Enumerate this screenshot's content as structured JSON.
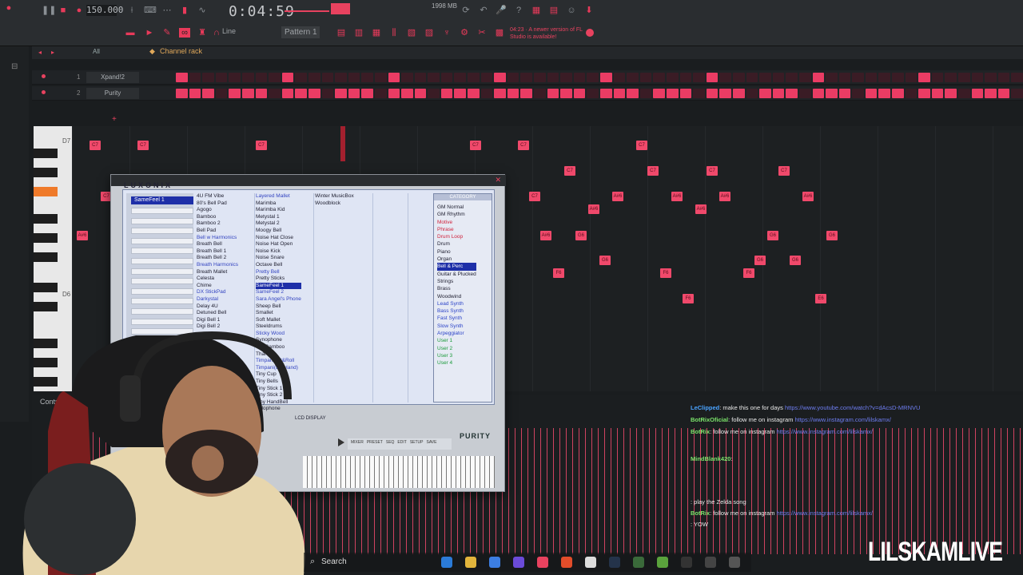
{
  "toolbar": {
    "tempo": "150.000",
    "time": "0:04:59",
    "line_mode": "Line",
    "pattern": "Pattern 1",
    "memory": "1998 MB",
    "notice": "04:23 · A newer version of FL Studio is available!",
    "accent": "#e83a5a"
  },
  "channel_rack": {
    "filter": "All",
    "title": "Channel rack",
    "channels": [
      {
        "num": "1",
        "name": "Xpand!2"
      },
      {
        "num": "2",
        "name": "Purity"
      }
    ]
  },
  "piano_roll": {
    "key_labels": [
      "D7",
      "D6"
    ],
    "notes": [
      "C7",
      "C7",
      "C7",
      "C7",
      "C7",
      "C7",
      "C7",
      "C7",
      "C7",
      "C7",
      "C7",
      "C7",
      "A#6",
      "A#6",
      "A#6",
      "A#6",
      "A#6",
      "A#6",
      "A#6",
      "A#6",
      "G6",
      "G6",
      "G6",
      "G6",
      "G6",
      "G6",
      "F6",
      "F6",
      "F6",
      "F6",
      "E6",
      "E6",
      "E6",
      "E6",
      "D6",
      "D6",
      "D6",
      "D6"
    ],
    "control_label": "Control"
  },
  "plugin": {
    "brand": "LUXONIX",
    "bank": "SameFeel 1",
    "col1": [
      "4U FM Vibe",
      "80's Bell Pad",
      "Agogo",
      "Bamboo",
      "Bamboo 2",
      "Bell Pad",
      "Bell w Harmonics",
      "Breath Bell",
      "Breath Bell 1",
      "Breath Bell 2",
      "Breath Harmonics",
      "Breath Mallet",
      "Celesta",
      "Chime",
      "DX StickPad",
      "Darkystal",
      "Delay 4U",
      "Detuned Bell",
      "Digi Bell 1",
      "Digi Bell 2"
    ],
    "col2": [
      "Layered Mallet",
      "Marimba",
      "Marimba Kid",
      "Metystal 1",
      "Metystal 2",
      "Moogy Bell",
      "Noise Hat Close",
      "Noise Hat Open",
      "Noise Kick",
      "Noise Snare",
      "Octave Bell",
      "Pretty Bell",
      "Pretty Sticks",
      "SameFeel 1",
      "SameFeel 2",
      "Sara Angel's Phone",
      "Sheep Bell",
      "Smallet",
      "Soft Mallet",
      "Steeldrums",
      "Sticky Wood",
      "Synophone",
      "Tek Bamboo",
      "Thai",
      "Timpani Hit&Roll",
      "Timpani(LR Hand)",
      "Tiny Cup",
      "Tiny Bells",
      "Tiny Stick 1",
      "Tiny Stick 2",
      "Tiny HandBell",
      "Xylophone"
    ],
    "col3": [
      "Winter MusicBox",
      "Woodblock"
    ],
    "category_title": "CATEGORY",
    "categories": [
      "GM Normal",
      "GM Rhythm",
      "Motive",
      "Phrase",
      "Drum Loop",
      "Drum",
      "Piano",
      "Organ",
      "Bell & Perc",
      "Guitar & Plucked",
      "Strings",
      "Brass",
      "Woodwind",
      "Lead Synth",
      "Bass Synth",
      "Fast Synth",
      "Slow Synth",
      "Arpeggiator",
      "User 1",
      "User 2",
      "User 3",
      "User 4"
    ],
    "lcd_label": "LCD DISPLAY",
    "product": "PURITY",
    "tabs": [
      "MIXER",
      "PRESET",
      "SEQ",
      "EDIT",
      "SETUP",
      "SAVE"
    ]
  },
  "chat": [
    {
      "user": "LeClipped",
      "msg": ": make this one for days ",
      "link": "https://www.youtube.com/watch?v=dAcsD-MRNVU",
      "color": "#4aa3ff"
    },
    {
      "user": "BotRixOficial",
      "msg": ": follow me on instagram ",
      "link": "https://www.instagram.com/lilskamx/",
      "color": "#7be36a"
    },
    {
      "user": "BotRix",
      "msg": ": follow me on instagram ",
      "link": "https://www.instagram.com/lilskamx/",
      "color": "#7be36a"
    },
    {
      "user": "MindBlank420",
      "msg": ":",
      "link": "",
      "color": "#7be36a"
    },
    {
      "user": "",
      "msg": ": play the Zelda song",
      "link": "",
      "color": "#e8425f"
    },
    {
      "user": "BotRix",
      "msg": ": follow me on instagram ",
      "link": "https://www.instagram.com/lilskamx/",
      "color": "#7be36a"
    },
    {
      "user": "",
      "msg": ": YOW",
      "link": "",
      "color": "#e8425f"
    }
  ],
  "taskbar": {
    "search": "Search"
  },
  "watermark": "LILSKAMLIVE"
}
